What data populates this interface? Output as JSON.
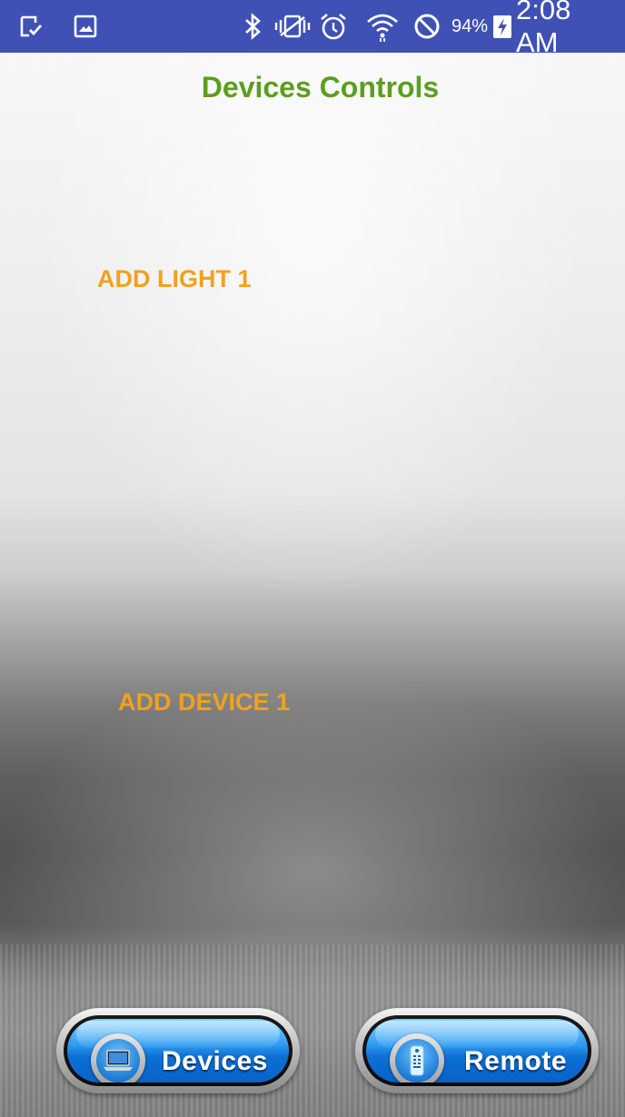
{
  "status_bar": {
    "battery_percent": "94%",
    "time": "2:08 AM",
    "left_icons": [
      "download-done-icon",
      "image-icon"
    ],
    "right_icons": [
      "bluetooth-icon",
      "vibrate-icon",
      "alarm-icon",
      "wifi-icon",
      "do-not-disturb-icon",
      "battery-charging-icon"
    ]
  },
  "header": {
    "title": "Devices Controls"
  },
  "main": {
    "add_light_label": "ADD LIGHT 1",
    "add_device_label": "ADD DEVICE 1"
  },
  "bottom_bar": {
    "devices_button_label": "Devices",
    "remote_button_label": "Remote",
    "devices_icon": "laptop-icon",
    "remote_icon": "remote-control-icon"
  },
  "colors": {
    "status_bar_bg": "#3f51b5",
    "title_color": "#5c9e1e",
    "add_label_color": "#f0a21e",
    "button_blue": "#0d6fd4"
  }
}
